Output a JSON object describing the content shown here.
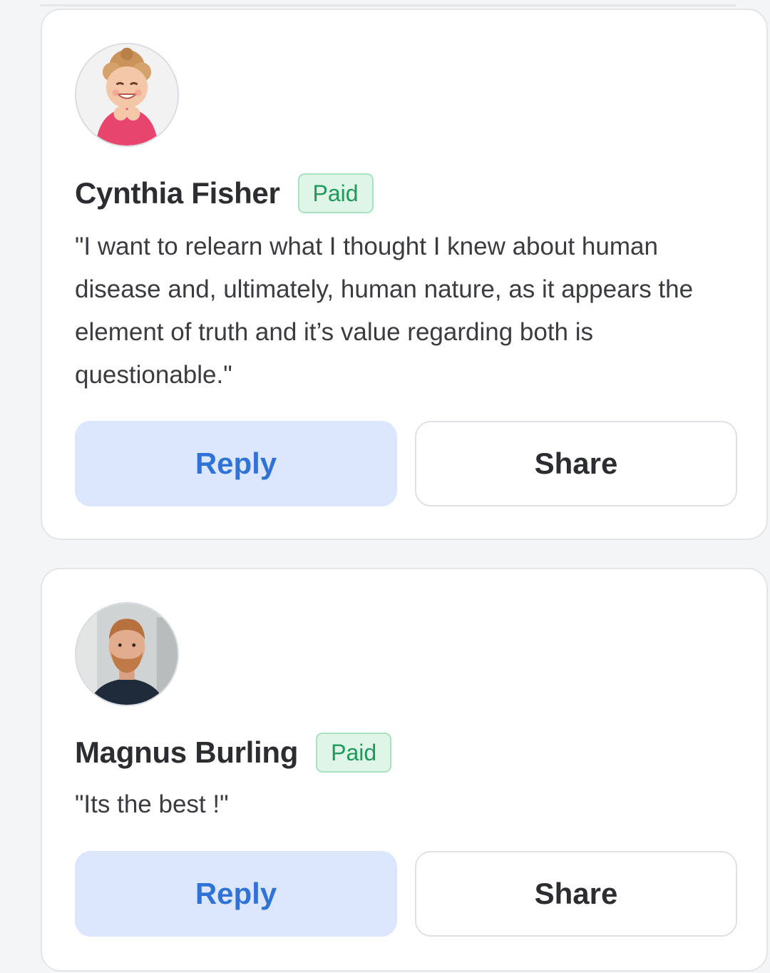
{
  "comments": [
    {
      "author": "Cynthia Fisher",
      "badge": "Paid",
      "text": "\"I want to relearn what I thought I knew about human disease and, ultimately, human nature, as it appears the element of truth and it’s value regarding both is questionable.\"",
      "reply_label": "Reply",
      "share_label": "Share"
    },
    {
      "author": "Magnus Burling",
      "badge": "Paid",
      "text": "\"Its the best !\"",
      "reply_label": "Reply",
      "share_label": "Share"
    }
  ],
  "colors": {
    "badge_text": "#1f9a5b",
    "badge_bg": "#def5e8",
    "reply_text": "#2f73d6",
    "reply_bg": "#dce7fd"
  }
}
